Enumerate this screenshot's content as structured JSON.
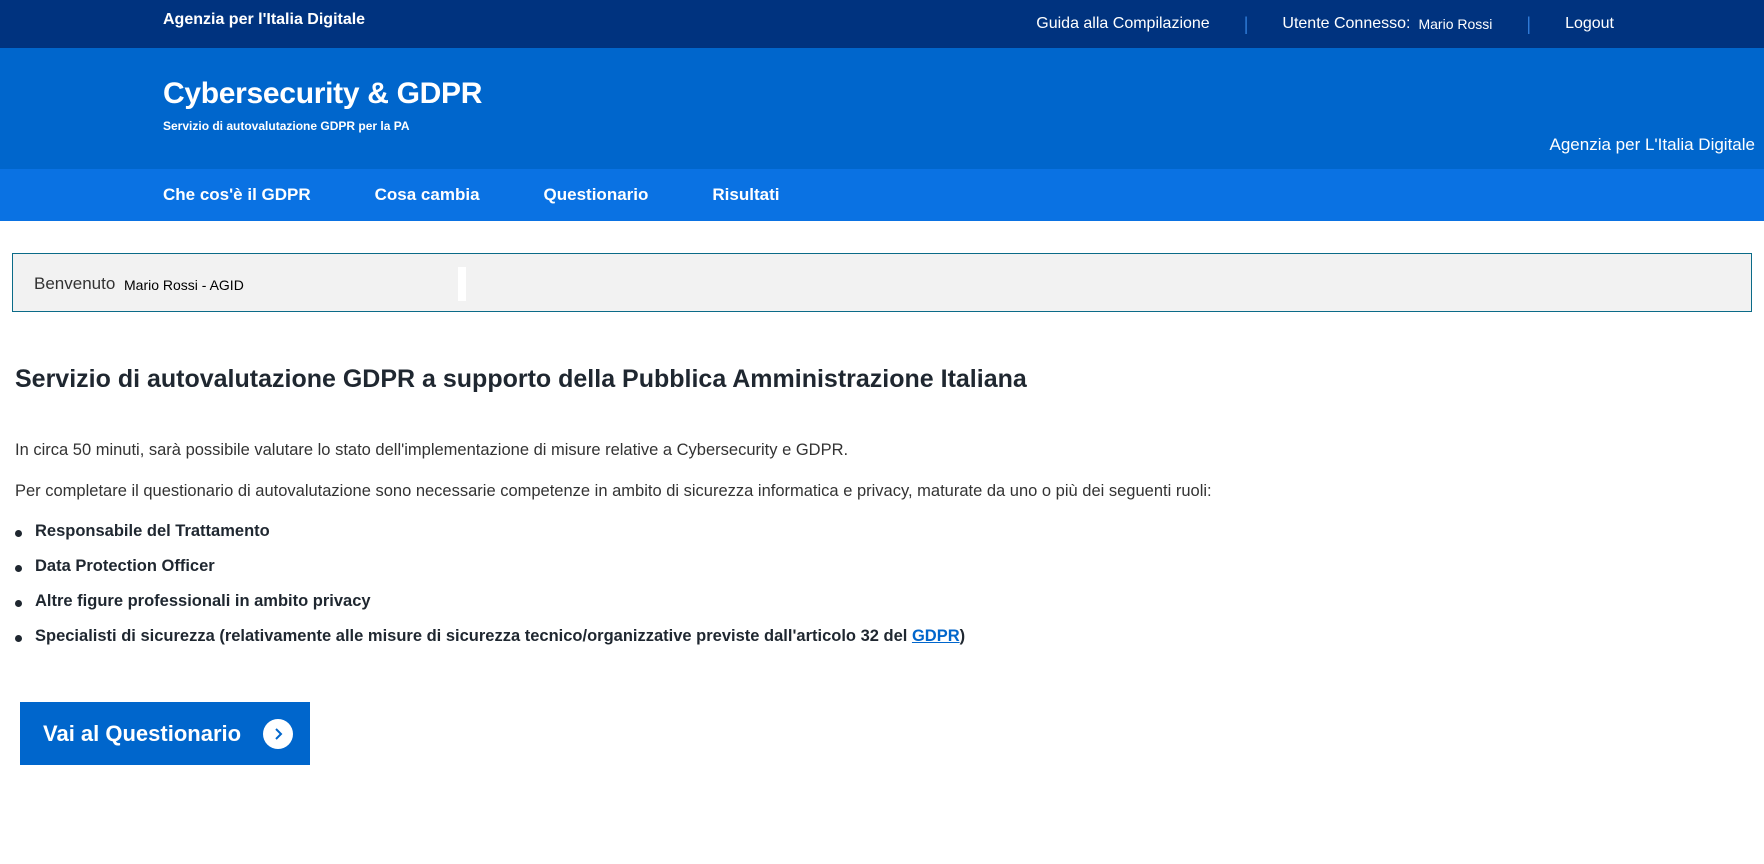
{
  "topbar": {
    "brand": "Agenzia per l'Italia Digitale",
    "guide_link": "Guida alla Compilazione",
    "user_label": "Utente Connesso:",
    "user_name": "Mario Rossi",
    "logout": "Logout",
    "separator": "|"
  },
  "header": {
    "title": "Cybersecurity & GDPR",
    "subtitle": "Servizio di autovalutazione GDPR per la PA",
    "agency": "Agenzia per L'Italia Digitale"
  },
  "nav": {
    "items": [
      {
        "label": "Che cos'è il GDPR"
      },
      {
        "label": "Cosa cambia"
      },
      {
        "label": "Questionario"
      },
      {
        "label": "Risultati"
      }
    ]
  },
  "welcome": {
    "label": "Benvenuto",
    "name": "Mario Rossi - AGID"
  },
  "main": {
    "title": "Servizio di autovalutazione GDPR a supporto della Pubblica Amministrazione Italiana",
    "paragraph1": "In circa 50 minuti, sarà possibile valutare lo stato dell'implementazione di misure relative a Cybersecurity e GDPR.",
    "paragraph2": "Per completare il questionario di autovalutazione sono necessarie competenze in ambito di sicurezza informatica e privacy, maturate da uno o più dei seguenti ruoli:",
    "roles": [
      "Responsabile del Trattamento",
      "Data Protection Officer",
      "Altre figure professionali in ambito privacy"
    ],
    "role4_prefix": "Specialisti di sicurezza (relativamente alle misure di sicurezza tecnico/organizzative previste dall'articolo 32 del ",
    "role4_link": "GDPR",
    "role4_suffix": ")"
  },
  "cta": {
    "label": "Vai al Questionario",
    "icon": "chevron-right-icon"
  },
  "colors": {
    "topbar": "#00337f",
    "header": "#0066cc",
    "nav": "#0a72e3",
    "button": "#0066cc"
  }
}
